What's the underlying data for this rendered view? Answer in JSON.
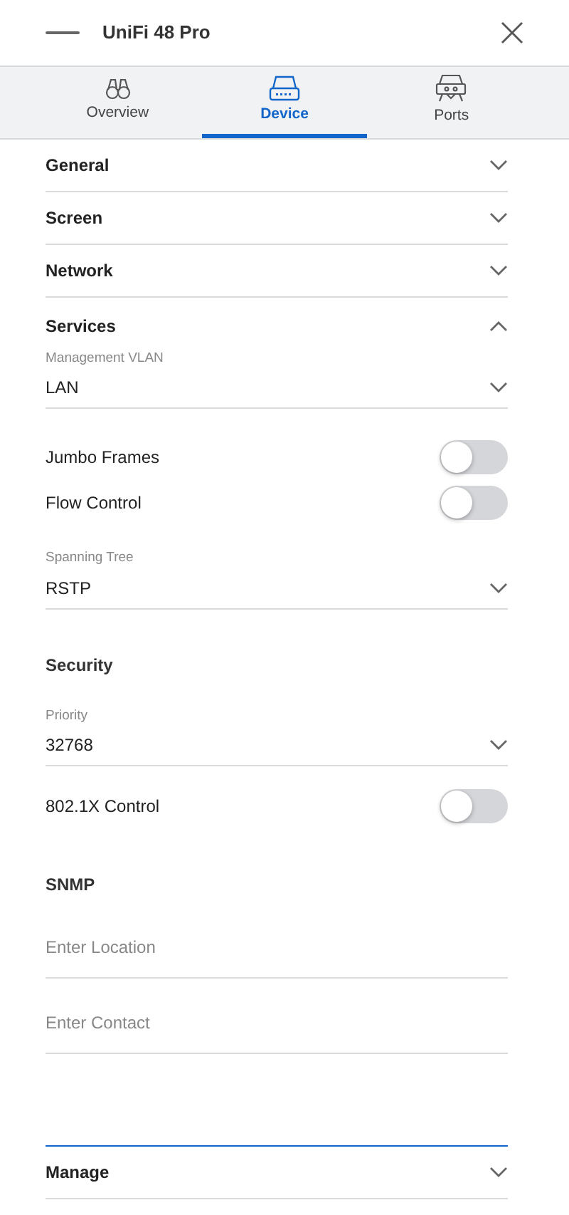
{
  "header": {
    "title": "UniFi 48 Pro"
  },
  "tabs": [
    {
      "label": "Overview",
      "kind": "binoculars",
      "selected": false
    },
    {
      "label": "Device",
      "kind": "device",
      "selected": true
    },
    {
      "label": "Ports",
      "kind": "ports",
      "selected": false
    }
  ],
  "sections": [
    {
      "title": "General",
      "expanded": false
    },
    {
      "title": "Screen",
      "expanded": false
    },
    {
      "title": "Network",
      "expanded": false
    },
    {
      "title": "Services",
      "expanded": true,
      "items": [
        {
          "kind": "select",
          "label": "Management VLAN",
          "value": "LAN"
        },
        {
          "kind": "toggle",
          "label": "Jumbo Frames",
          "on": false
        },
        {
          "kind": "toggle",
          "label": "Flow Control",
          "on": false
        },
        {
          "kind": "select",
          "label": "Spanning Tree",
          "value": "RSTP"
        },
        {
          "kind": "heading",
          "text": "Security"
        },
        {
          "kind": "select",
          "label": "Priority",
          "value": "32768"
        },
        {
          "kind": "toggle",
          "label": "802.1X Control",
          "on": false
        },
        {
          "kind": "heading",
          "text": "SNMP"
        },
        {
          "kind": "input",
          "placeholder": "Enter Location",
          "focused": false
        },
        {
          "kind": "input",
          "placeholder": "Enter Contact",
          "focused": false
        },
        {
          "kind": "input",
          "focused": true
        }
      ]
    },
    {
      "title": "Manage",
      "expanded": false
    }
  ]
}
